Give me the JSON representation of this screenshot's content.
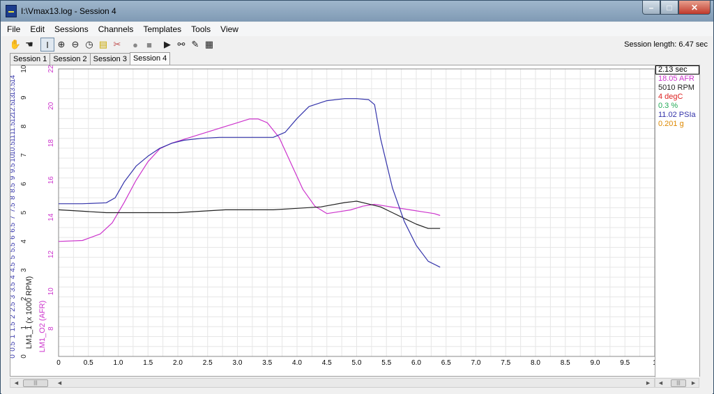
{
  "window": {
    "title": "I:\\Vmax13.log - Session 4",
    "caption": {
      "minimize": "–",
      "maximize": "□",
      "close": "✕"
    }
  },
  "menu": [
    "File",
    "Edit",
    "Sessions",
    "Channels",
    "Templates",
    "Tools",
    "View"
  ],
  "toolbar": {
    "icons": [
      {
        "name": "hand-pan-icon",
        "glyph": "✋"
      },
      {
        "name": "hand-grab-icon",
        "glyph": "☚"
      },
      {
        "name": "text-cursor-icon",
        "glyph": "I"
      },
      {
        "name": "zoom-in-icon",
        "glyph": "⊕"
      },
      {
        "name": "zoom-out-icon",
        "glyph": "⊖"
      },
      {
        "name": "clock-icon",
        "glyph": "◷"
      },
      {
        "name": "note-icon",
        "glyph": "▤"
      },
      {
        "name": "disconnect-icon",
        "glyph": "✂"
      },
      {
        "name": "record-icon",
        "glyph": "●"
      },
      {
        "name": "stop-icon",
        "glyph": "■"
      },
      {
        "name": "play-icon",
        "glyph": "▶"
      },
      {
        "name": "binoculars-icon",
        "glyph": "⚯"
      },
      {
        "name": "chart-icon",
        "glyph": "✎"
      },
      {
        "name": "table-icon",
        "glyph": "▦"
      }
    ],
    "session_length": "Session length:  6.47 sec"
  },
  "tabs": [
    {
      "label": "Session 1",
      "active": false
    },
    {
      "label": "Session 2",
      "active": false
    },
    {
      "label": "Session 3",
      "active": false
    },
    {
      "label": "Session 4",
      "active": true
    }
  ],
  "readout": {
    "time": "2.13 sec",
    "items": [
      {
        "text": "18.05 AFR",
        "color": "#cc33cc"
      },
      {
        "text": "5010 RPM",
        "color": "#222222"
      },
      {
        "text": "4 degC",
        "color": "#dd2222"
      },
      {
        "text": "0.3 %",
        "color": "#22aa55"
      },
      {
        "text": "11.02 PSIa",
        "color": "#3333aa"
      },
      {
        "text": "0.201 g",
        "color": "#dd8800"
      }
    ]
  },
  "chart_data": {
    "type": "line",
    "xlabel": "",
    "xlim": [
      0,
      10
    ],
    "x_ticks": [
      "0",
      "0.5",
      "1.0",
      "1.5",
      "2.0",
      "2.5",
      "3.0",
      "3.5",
      "4.0",
      "4.5",
      "5.0",
      "5.5",
      "6.0",
      "6.5",
      "7.0",
      "7.5",
      "8.0",
      "8.5",
      "9.0",
      "9.5",
      "1"
    ],
    "axes": [
      {
        "label": "",
        "color": "#3333aa",
        "range": [
          0,
          14.5
        ],
        "ticks": [
          "0",
          "0.5",
          "1",
          "1.5",
          "2",
          "2.5",
          "3",
          "3.5",
          "4",
          "4.5",
          "5",
          "5.5",
          "6",
          "6.5",
          "7",
          "7.5",
          "8",
          "8.5",
          "9",
          "9.5",
          "10",
          "10.5",
          "11",
          "11.5",
          "12",
          "12.5",
          "13",
          "13.5",
          "14"
        ]
      },
      {
        "label": "LM1_1 (x 1000 RPM)",
        "color": "#222222",
        "range": [
          0,
          10
        ],
        "ticks": [
          "0",
          "1",
          "2",
          "3",
          "4",
          "5",
          "6",
          "7",
          "8",
          "9",
          "10"
        ]
      },
      {
        "label": "LM1_O2 (AFR)",
        "color": "#cc33cc",
        "range": [
          6.5,
          22
        ],
        "ticks": [
          "8",
          "10",
          "12",
          "14",
          "16",
          "18",
          "20",
          "22"
        ]
      }
    ],
    "series": [
      {
        "color": "#cc33cc",
        "axis": 2,
        "x": [
          0,
          0.4,
          0.7,
          0.9,
          1.1,
          1.3,
          1.5,
          1.7,
          1.9,
          2.2,
          2.5,
          2.8,
          3.0,
          3.2,
          3.35,
          3.5,
          3.7,
          3.9,
          4.1,
          4.3,
          4.5,
          4.7,
          4.9,
          5.1,
          5.3,
          5.5,
          5.7,
          5.9,
          6.1,
          6.3,
          6.4
        ],
        "y": [
          12.7,
          12.75,
          13.1,
          13.7,
          14.8,
          16.0,
          17.0,
          17.7,
          18.0,
          18.3,
          18.6,
          18.9,
          19.1,
          19.3,
          19.3,
          19.1,
          18.3,
          16.9,
          15.5,
          14.6,
          14.2,
          14.3,
          14.4,
          14.6,
          14.7,
          14.6,
          14.5,
          14.4,
          14.3,
          14.2,
          14.1
        ]
      },
      {
        "color": "#222222",
        "axis": 1,
        "x": [
          0,
          0.4,
          0.8,
          1.2,
          1.6,
          2.0,
          2.4,
          2.8,
          3.2,
          3.6,
          4.0,
          4.4,
          4.8,
          5.0,
          5.2,
          5.4,
          5.6,
          5.8,
          6.0,
          6.2,
          6.4
        ],
        "y": [
          5.1,
          5.05,
          5.0,
          5.0,
          5.0,
          5.0,
          5.05,
          5.1,
          5.1,
          5.1,
          5.15,
          5.2,
          5.35,
          5.4,
          5.3,
          5.2,
          5.0,
          4.8,
          4.6,
          4.45,
          4.45
        ]
      },
      {
        "color": "#3333aa",
        "axis": 0,
        "x": [
          0,
          0.4,
          0.8,
          0.95,
          1.1,
          1.3,
          1.5,
          1.7,
          1.9,
          2.1,
          2.4,
          2.7,
          3.0,
          3.3,
          3.6,
          3.8,
          4.0,
          4.2,
          4.5,
          4.8,
          5.0,
          5.2,
          5.3,
          5.4,
          5.6,
          5.8,
          6.0,
          6.2,
          6.4
        ],
        "y": [
          7.7,
          7.7,
          7.75,
          8.0,
          8.8,
          9.6,
          10.1,
          10.5,
          10.75,
          10.9,
          11.0,
          11.05,
          11.05,
          11.05,
          11.05,
          11.3,
          12.0,
          12.6,
          12.9,
          13.0,
          13.0,
          12.95,
          12.7,
          11.0,
          8.5,
          6.8,
          5.6,
          4.8,
          4.5
        ]
      }
    ]
  }
}
